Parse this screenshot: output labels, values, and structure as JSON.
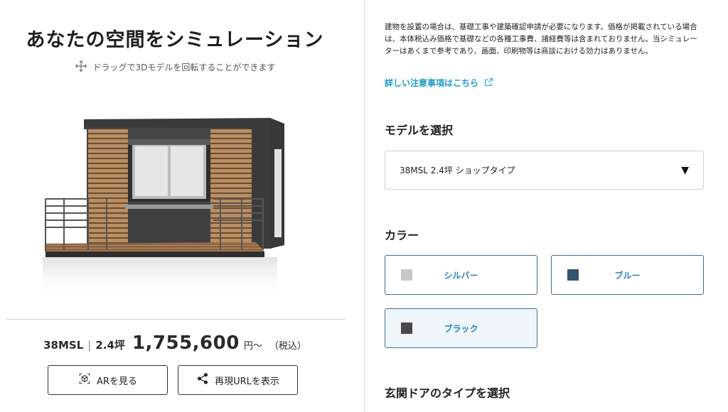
{
  "left": {
    "title": "あなたの空間をシミュレーション",
    "drag_hint": "ドラッグで3Dモデルを回転することができます",
    "price": {
      "model": "38MSL",
      "separator": "|",
      "size": "2.4坪",
      "amount": "1,755,600",
      "unit": "円〜",
      "tax_note": "（税込）"
    },
    "buttons": {
      "ar_label": "ARを見る",
      "url_label": "再現URLを表示"
    }
  },
  "right": {
    "notice": "建物を設置の場合は、基礎工事や建築確認申請が必要になります。価格が掲載されている場合は、本体税込み価格で基礎などの各種工事費、諸経費等は含まれておりません。当シミュレーターはあくまで参考であり、画面、印刷物等は商談における効力はありません。",
    "detail_link": "詳しい注意事項はこちら",
    "model_section": {
      "title": "モデルを選択",
      "selected": "38MSL 2.4坪 ショップタイプ"
    },
    "color_section": {
      "title": "カラー",
      "options": [
        {
          "label": "シルバー",
          "swatch": "#c8c8c8",
          "selected": false
        },
        {
          "label": "ブルー",
          "swatch": "#34536e",
          "selected": false
        },
        {
          "label": "ブラック",
          "swatch": "#4a4a4a",
          "selected": true
        }
      ]
    },
    "door_section": {
      "title": "玄関ドアのタイプを選択"
    }
  },
  "icons": {
    "drag": "move-arrows-icon",
    "ar": "ar-cube-icon",
    "share": "share-icon",
    "external": "external-link-icon",
    "caret": "caret-down-icon"
  },
  "colors": {
    "accent": "#2a83b9",
    "link": "#1f9ccc",
    "border_active": "#3d6e93"
  }
}
